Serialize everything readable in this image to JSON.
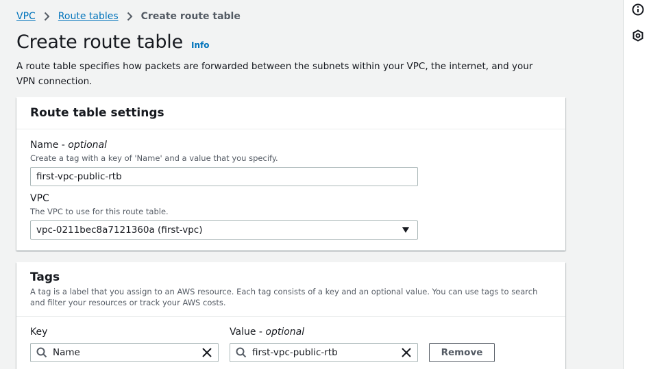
{
  "breadcrumb": {
    "items": [
      "VPC",
      "Route tables"
    ],
    "current": "Create route table"
  },
  "header": {
    "title": "Create route table",
    "info_label": "Info",
    "description": "A route table specifies how packets are forwarded between the subnets within your VPC, the internet, and your VPN connection."
  },
  "settings": {
    "title": "Route table settings",
    "name_label": "Name",
    "name_optional": "optional",
    "name_hint": "Create a tag with a key of 'Name' and a value that you specify.",
    "name_value": "first-vpc-public-rtb",
    "vpc_label": "VPC",
    "vpc_hint": "The VPC to use for this route table.",
    "vpc_value": "vpc-0211bec8a7121360a (first-vpc)"
  },
  "tags": {
    "title": "Tags",
    "description": "A tag is a label that you assign to an AWS resource. Each tag consists of a key and an optional value. You can use tags to search and filter your resources or track your AWS costs.",
    "key_label": "Key",
    "value_label": "Value",
    "value_optional": "optional",
    "rows": [
      {
        "key": "Name",
        "value": "first-vpc-public-rtb"
      }
    ],
    "remove_label": "Remove"
  },
  "icons": {
    "rail": [
      "info-circle-icon",
      "shield-settings-icon"
    ],
    "search": "search-icon",
    "clear": "close-icon",
    "separator": "chevron-right-icon",
    "dropdown": "caret-down-icon"
  },
  "colors": {
    "link": "#0073bb",
    "background": "#f2f3f3",
    "panel": "#ffffff",
    "border": "#aab7b8",
    "text": "#16191f",
    "secondary_text": "#545b64"
  }
}
